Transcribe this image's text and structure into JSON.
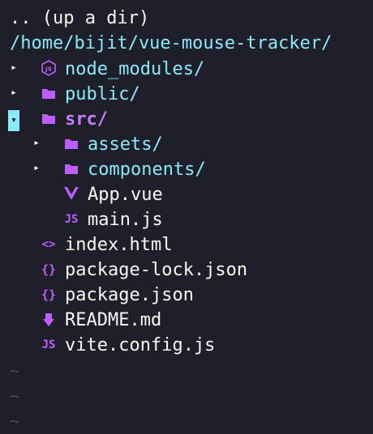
{
  "up_label": ".. (up a dir)",
  "cwd": "/home/bijit/vue-mouse-tracker/",
  "tree": [
    {
      "label": "node_modules/",
      "icon": "nodejs-icon",
      "arrow": "collapsed",
      "kind": "dir"
    },
    {
      "label": "public/",
      "icon": "folder-icon",
      "arrow": "collapsed",
      "kind": "dir"
    },
    {
      "label": "src/",
      "icon": "folder-icon",
      "arrow": "expanded",
      "kind": "dir-open"
    },
    {
      "label": "assets/",
      "icon": "folder-icon",
      "arrow": "collapsed",
      "kind": "dir"
    },
    {
      "label": "components/",
      "icon": "folder-icon",
      "arrow": "collapsed",
      "kind": "dir"
    },
    {
      "label": "App.vue",
      "icon": "vue-icon",
      "kind": "file"
    },
    {
      "label": "main.js",
      "icon": "js-icon",
      "kind": "file"
    },
    {
      "label": "index.html",
      "icon": "html-icon",
      "kind": "file"
    },
    {
      "label": "package-lock.json",
      "icon": "json-icon",
      "kind": "file"
    },
    {
      "label": "package.json",
      "icon": "json-icon",
      "kind": "file"
    },
    {
      "label": "README.md",
      "icon": "markdown-icon",
      "kind": "file"
    },
    {
      "label": "vite.config.js",
      "icon": "js-icon",
      "kind": "file"
    }
  ],
  "icons": {
    "arrow_collapsed": "▸",
    "arrow_expanded": "▾",
    "js": "JS",
    "json": "{}",
    "html": "<>",
    "tilde": "~"
  },
  "colors": {
    "background": "#1e1f29",
    "dir": "#8be9fd",
    "icon": "#bd5fff"
  }
}
